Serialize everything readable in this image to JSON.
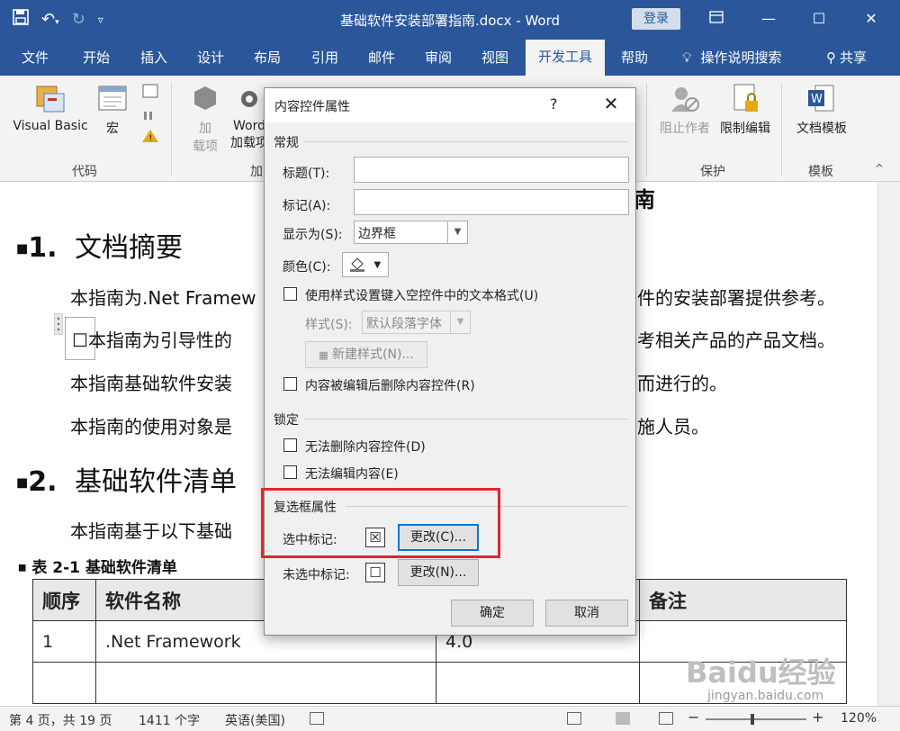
{
  "app": {
    "title": "基础软件安装部署指南.docx  -  Word",
    "login": "登录"
  },
  "tabs": [
    "文件",
    "开始",
    "插入",
    "设计",
    "布局",
    "引用",
    "邮件",
    "审阅",
    "视图",
    "开发工具",
    "帮助",
    "操作说明搜索",
    "共享"
  ],
  "ribbon": {
    "vb": "Visual Basic",
    "macro": "宏",
    "addin_1": "加",
    "addin_2": "载项",
    "word_1": "Word",
    "word_2": "加载项",
    "group_code": "代码",
    "group_addin": "加",
    "block_authors": "阻止作者",
    "restrict": "限制编辑",
    "group_protect": "保护",
    "doc_template": "文档模板",
    "group_template": "模板"
  },
  "doc": {
    "heading_top": "南",
    "h1_num": "1.",
    "h1_text": "文档摘要",
    "p1a": "本指南为.Net Framew",
    "p1b": "件的安装部署提供参考。",
    "p2a": "本指南为引导性的",
    "p2b": "考相关产品的产品文档。",
    "p3a": "本指南基础软件安装",
    "p3b": "而进行的。",
    "p4a": "本指南的使用对象是",
    "p4b": "施人员。",
    "h2_num": "2.",
    "h2_text": "基础软件清单",
    "p5": "本指南基于以下基础",
    "caption": "表  2-1  基础软件清单",
    "table": {
      "headers": [
        "顺序",
        "软件名称",
        "",
        "备注"
      ],
      "rows": [
        [
          "1",
          ".Net Framework",
          "4.0",
          ""
        ]
      ]
    }
  },
  "dialog": {
    "title": "内容控件属性",
    "help": "?",
    "sec_general": "常规",
    "title_label": "标题(T):",
    "tag_label": "标记(A):",
    "show_as_label": "显示为(S):",
    "show_as_value": "边界框",
    "color_label": "颜色(C):",
    "use_style": "使用样式设置键入空控件中的文本格式(U)",
    "style_label": "样式(S):",
    "style_value": "默认段落字体",
    "new_style": "新建样式(N)...",
    "remove_after_edit": "内容被编辑后删除内容控件(R)",
    "sec_lock": "锁定",
    "cannot_delete": "无法删除内容控件(D)",
    "cannot_edit": "无法编辑内容(E)",
    "sec_checkbox": "复选框属性",
    "checked_label": "选中标记:",
    "checked_symbol": "☒",
    "change_c": "更改(C)...",
    "unchecked_label": "未选中标记:",
    "unchecked_symbol": "☐",
    "change_n": "更改(N)...",
    "ok": "确定",
    "cancel": "取消"
  },
  "status": {
    "page": "第 4 页，共 19 页",
    "words": "1411 个字",
    "lang": "英语(美国)",
    "zoom": "120%"
  },
  "watermark": {
    "brand": "Baidu经验",
    "url": "jingyan.baidu.com"
  },
  "colors": {
    "brand": "#2b579a",
    "highlight": "#e8242b"
  }
}
